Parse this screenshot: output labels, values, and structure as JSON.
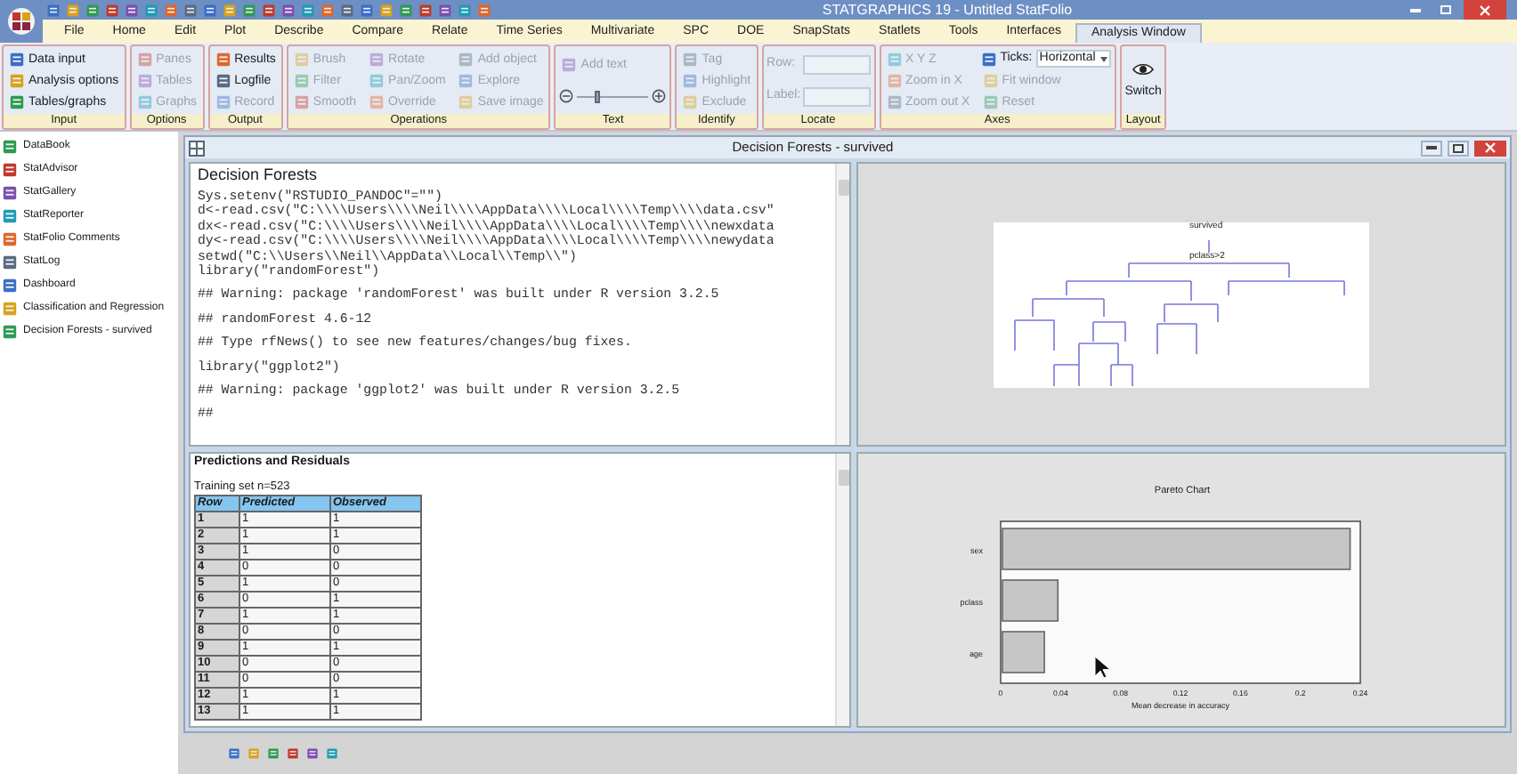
{
  "window": {
    "title": "STATGRAPHICS 19 - Untitled StatFolio"
  },
  "menu": [
    {
      "label": "File",
      "selected": false
    },
    {
      "label": "Home",
      "selected": false
    },
    {
      "label": "Edit",
      "selected": false
    },
    {
      "label": "Plot",
      "selected": false
    },
    {
      "label": "Describe",
      "selected": false
    },
    {
      "label": "Compare",
      "selected": false
    },
    {
      "label": "Relate",
      "selected": false
    },
    {
      "label": "Time Series",
      "selected": false
    },
    {
      "label": "Multivariate",
      "selected": false
    },
    {
      "label": "SPC",
      "selected": false
    },
    {
      "label": "DOE",
      "selected": false
    },
    {
      "label": "SnapStats",
      "selected": false
    },
    {
      "label": "Statlets",
      "selected": false
    },
    {
      "label": "Tools",
      "selected": false
    },
    {
      "label": "Interfaces",
      "selected": false
    },
    {
      "label": "Analysis Window",
      "selected": true
    }
  ],
  "ribbon": [
    {
      "label": "Input",
      "items": [
        {
          "kind": "button",
          "label": "Data input",
          "disabled": false
        },
        {
          "kind": "button",
          "label": "Analysis options",
          "disabled": false
        },
        {
          "kind": "button",
          "label": "Tables/graphs",
          "disabled": false
        }
      ]
    },
    {
      "label": "Options",
      "items": [
        {
          "kind": "button",
          "label": "Panes",
          "disabled": true
        },
        {
          "kind": "button",
          "label": "Tables",
          "disabled": true
        },
        {
          "kind": "button",
          "label": "Graphs",
          "disabled": true
        }
      ]
    },
    {
      "label": "Output",
      "items": [
        {
          "kind": "button",
          "label": "Results",
          "disabled": false
        },
        {
          "kind": "button",
          "label": "Logfile",
          "disabled": false
        },
        {
          "kind": "button",
          "label": "Record",
          "disabled": true
        }
      ]
    },
    {
      "label": "Operations",
      "items": [
        {
          "kind": "button",
          "label": "Brush",
          "disabled": true
        },
        {
          "kind": "button",
          "label": "Filter",
          "disabled": true
        },
        {
          "kind": "button",
          "label": "Smooth",
          "disabled": true
        },
        {
          "kind": "button",
          "label": "Rotate",
          "disabled": true
        },
        {
          "kind": "button",
          "label": "Pan/Zoom",
          "disabled": true
        },
        {
          "kind": "button",
          "label": "Override",
          "disabled": true
        },
        {
          "kind": "button",
          "label": "Add object",
          "disabled": true
        },
        {
          "kind": "button",
          "label": "Explore",
          "disabled": true
        },
        {
          "kind": "button",
          "label": "Save image",
          "disabled": true
        }
      ]
    },
    {
      "label": "Text",
      "items": [
        {
          "kind": "button",
          "label": "Add text",
          "disabled": true
        },
        {
          "kind": "slider",
          "level": 0.25,
          "disabled": true
        }
      ]
    },
    {
      "label": "Identify",
      "items": [
        {
          "kind": "button",
          "label": "Tag",
          "disabled": true
        },
        {
          "kind": "button",
          "label": "Highlight",
          "disabled": true
        },
        {
          "kind": "button",
          "label": "Exclude",
          "disabled": true
        }
      ]
    },
    {
      "label": "Locate",
      "items": [
        {
          "kind": "field",
          "label": "Row:",
          "disabled": true
        },
        {
          "kind": "field",
          "label": "Label:",
          "disabled": true
        }
      ]
    },
    {
      "label": "Axes",
      "items": [
        {
          "kind": "button",
          "label": "X Y Z",
          "disabled": true
        },
        {
          "kind": "button",
          "label": "Zoom in X",
          "disabled": true
        },
        {
          "kind": "button",
          "label": "Zoom out X",
          "disabled": true
        },
        {
          "kind": "dropdown",
          "label": "Ticks:",
          "value": "Horizontal",
          "disabled": false
        },
        {
          "kind": "button",
          "label": "Fit window",
          "disabled": true
        },
        {
          "kind": "button",
          "label": "Reset",
          "disabled": true
        }
      ]
    },
    {
      "label": "Layout",
      "items": [
        {
          "kind": "large",
          "label": "Switch",
          "disabled": false
        }
      ]
    }
  ],
  "sidebar": {
    "items": [
      "DataBook",
      "StatAdvisor",
      "StatGallery",
      "StatReporter",
      "StatFolio Comments",
      "StatLog",
      "Dashboard",
      "Classification and Regression",
      "Decision Forests - survived"
    ]
  },
  "analysis_window": {
    "title": "Decision Forests - survived",
    "code_pane": {
      "heading": "Decision Forests",
      "blocks": [
        [
          "Sys.setenv(\"RSTUDIO_PANDOC\"=\"\")",
          "d<-read.csv(\"C:\\\\\\\\Users\\\\\\\\Neil\\\\\\\\AppData\\\\\\\\Local\\\\\\\\Temp\\\\\\\\data.csv\"",
          "dx<-read.csv(\"C:\\\\\\\\Users\\\\\\\\Neil\\\\\\\\AppData\\\\\\\\Local\\\\\\\\Temp\\\\\\\\newxdata",
          "dy<-read.csv(\"C:\\\\\\\\Users\\\\\\\\Neil\\\\\\\\AppData\\\\\\\\Local\\\\\\\\Temp\\\\\\\\newydata",
          "setwd(\"C:\\\\Users\\\\Neil\\\\AppData\\\\Local\\\\Temp\\\\\")",
          "library(\"randomForest\")"
        ],
        [
          "## Warning: package 'randomForest' was built under R version 3.2.5"
        ],
        [
          "## randomForest 4.6-12"
        ],
        [
          "## Type rfNews() to see new features/changes/bug fixes."
        ],
        [
          "library(\"ggplot2\")"
        ],
        [
          "## Warning: package 'ggplot2' was built under R version 3.2.5"
        ],
        [
          "##"
        ]
      ]
    },
    "tree_pane": {
      "labels": [
        "survived",
        "pclass>2"
      ]
    },
    "table_pane": {
      "heading": "Predictions and Residuals",
      "caption": "Training set n=523",
      "columns": [
        "Row",
        "Predicted",
        "Observed"
      ],
      "rows": [
        [
          "1",
          "1",
          "1"
        ],
        [
          "2",
          "1",
          "1"
        ],
        [
          "3",
          "1",
          "0"
        ],
        [
          "4",
          "0",
          "0"
        ],
        [
          "5",
          "1",
          "0"
        ],
        [
          "6",
          "0",
          "1"
        ],
        [
          "7",
          "1",
          "1"
        ],
        [
          "8",
          "0",
          "0"
        ],
        [
          "9",
          "1",
          "1"
        ],
        [
          "10",
          "0",
          "0"
        ],
        [
          "11",
          "0",
          "0"
        ],
        [
          "12",
          "1",
          "1"
        ],
        [
          "13",
          "1",
          "1"
        ]
      ]
    },
    "pareto_pane": {
      "chart_data": {
        "type": "bar",
        "orientation": "horizontal",
        "title": "Pareto Chart",
        "xlabel": "Mean decrease in accuracy",
        "categories": [
          "sex",
          "pclass",
          "age"
        ],
        "values": [
          0.232,
          0.037,
          0.028
        ],
        "xlim": [
          0,
          0.24
        ],
        "xticks": [
          0,
          0.04,
          0.08,
          0.12,
          0.16,
          0.2,
          0.24
        ]
      }
    }
  }
}
